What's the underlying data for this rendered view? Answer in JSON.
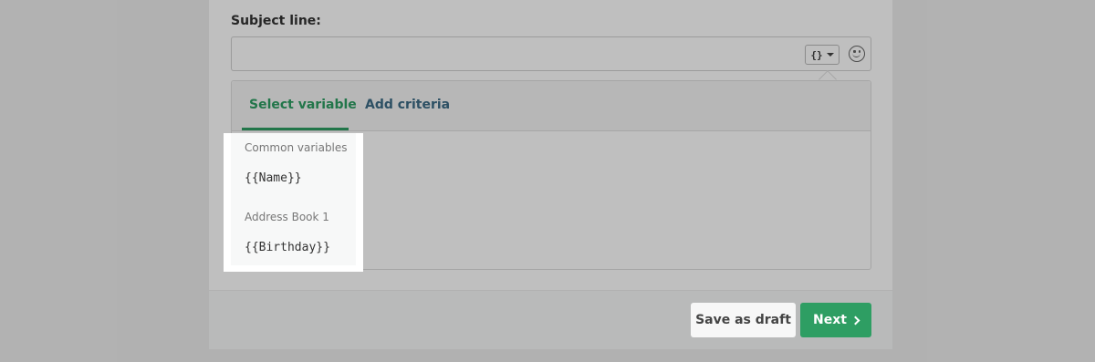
{
  "subject": {
    "label": "Subject line:",
    "value": "",
    "variable_button_glyph": "{}",
    "icons": [
      "variable-braces-icon",
      "chevron-down-icon",
      "smiley-icon"
    ]
  },
  "variables_panel": {
    "tabs": [
      {
        "label": "Select variable",
        "active": true
      },
      {
        "label": "Add criteria",
        "active": false
      }
    ]
  },
  "variable_menu": {
    "groups": [
      {
        "label": "Common variables",
        "items": [
          "{{Name}}"
        ]
      },
      {
        "label": "Address Book 1",
        "items": [
          "{{Birthday}}"
        ]
      }
    ]
  },
  "footer": {
    "save_draft_label": "Save as draft",
    "next_label": "Next"
  },
  "colors": {
    "accent": "#2e9e63",
    "link": "#3c6b86",
    "overlay": "rgba(0,0,0,0.25)"
  }
}
